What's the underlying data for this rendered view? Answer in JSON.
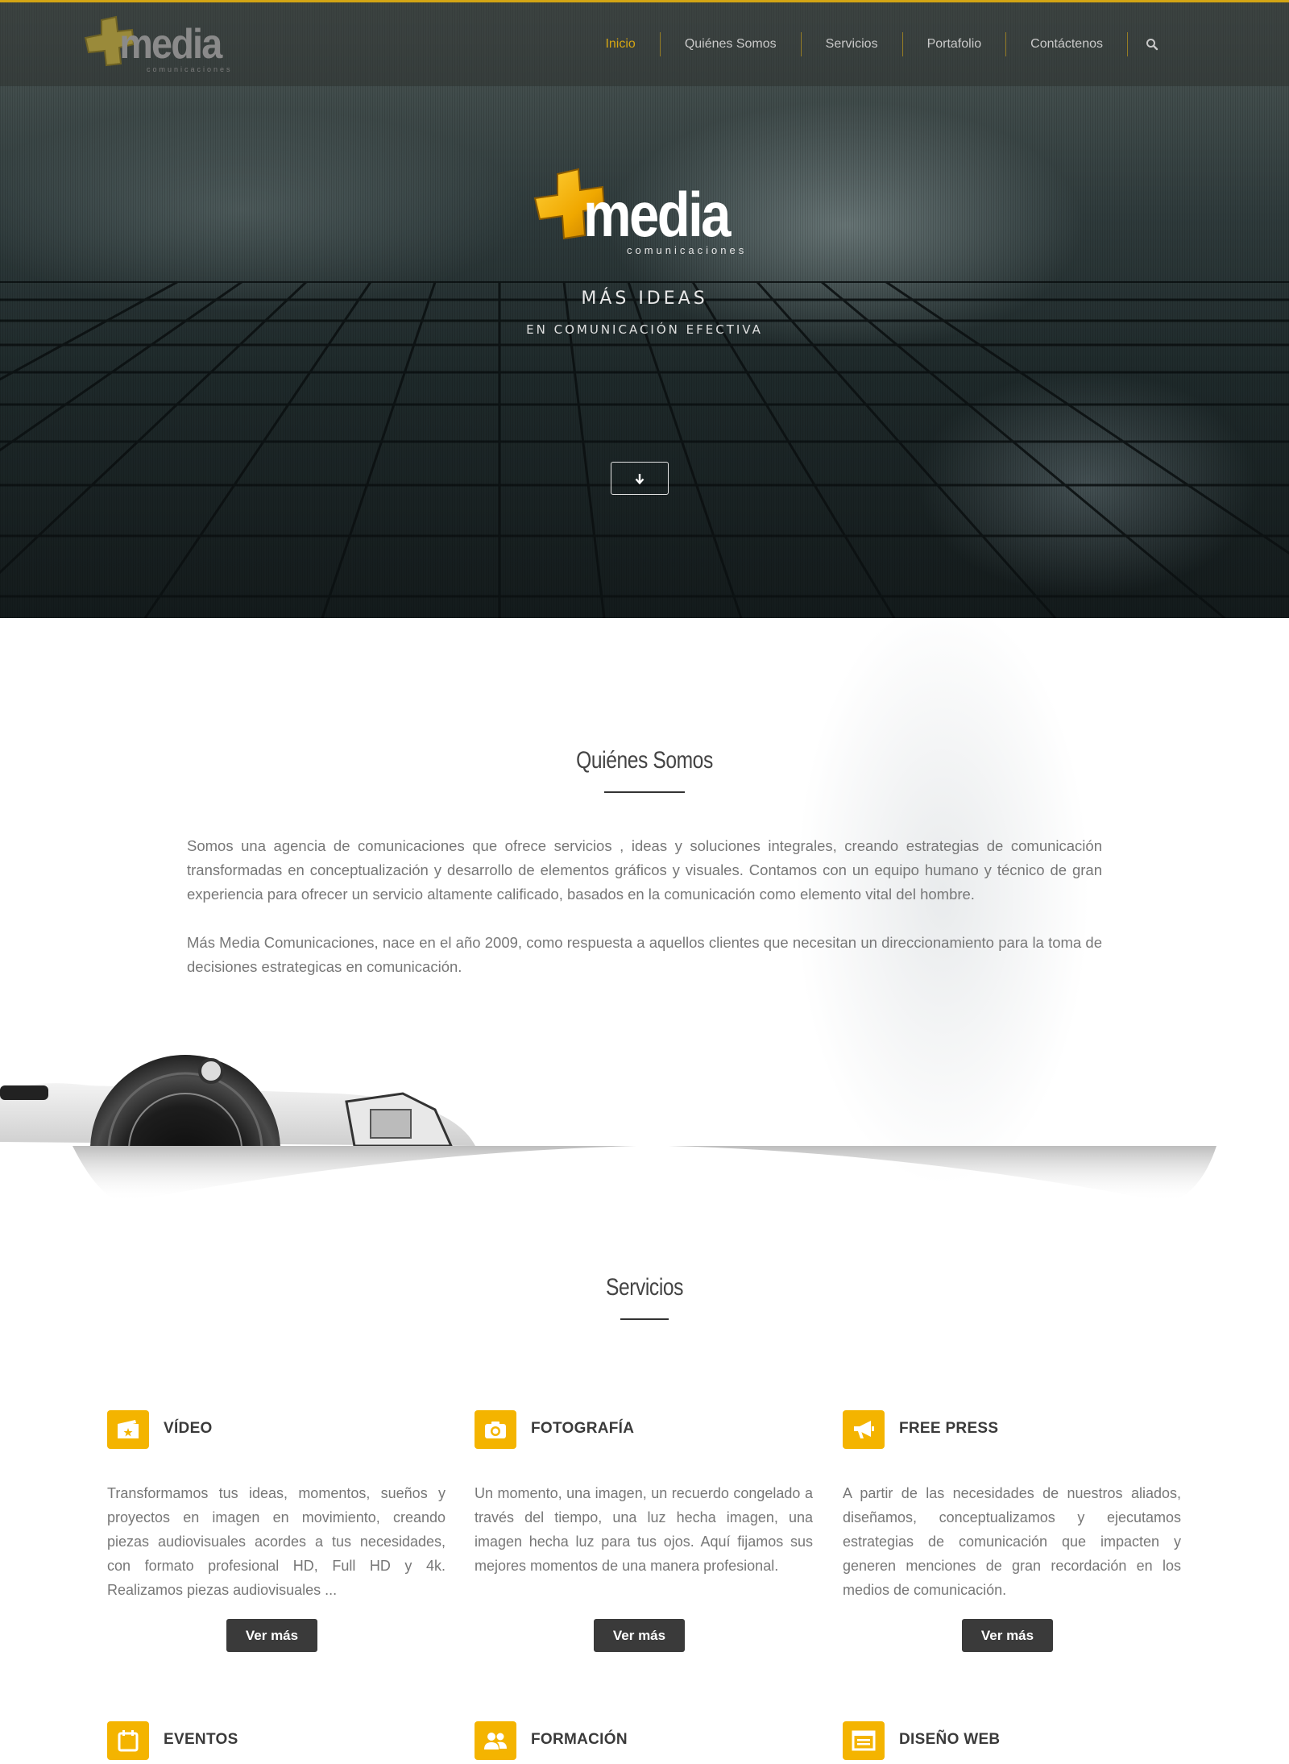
{
  "colors": {
    "accent": "#d4a514",
    "icon_bg": "#f4b400",
    "button_bg": "#3a3a3a"
  },
  "brand": {
    "logo_word": "media",
    "logo_tagline": "comunicaciones"
  },
  "nav": {
    "items": [
      {
        "label": "Inicio",
        "active": true
      },
      {
        "label": "Quiénes Somos"
      },
      {
        "label": "Servicios"
      },
      {
        "label": "Portafolio"
      },
      {
        "label": "Contáctenos"
      }
    ],
    "search_icon": "search-icon"
  },
  "hero": {
    "title": "MÁS IDEAS",
    "subtitle": "EN COMUNICACIÓN EFECTIVA",
    "scroll_icon": "arrow-down-icon"
  },
  "about": {
    "title": "Quiénes Somos",
    "paragraphs": [
      "Somos una agencia de comunicaciones que ofrece servicios , ideas y soluciones integrales, creando estrategias de comunicación transformadas en conceptualización y desarrollo de elementos gráficos y visuales. Contamos con un equipo humano y técnico de gran experiencia para ofrecer un servicio altamente calificado, basados en la comunicación como elemento vital del hombre.",
      "Más Media Comunicaciones, nace en el año 2009, como respuesta a aquellos clientes que necesitan un direccionamiento para la toma de decisiones estrategicas en comunicación."
    ]
  },
  "services": {
    "title": "Servicios",
    "items": [
      {
        "icon": "video-icon",
        "title": "VÍDEO",
        "text": "Transformamos tus ideas, momentos, sueños y proyectos en imagen en movimiento, creando piezas audiovisuales acordes a tus necesidades, con formato profesional HD, Full HD y 4k. Realizamos piezas audiovisuales ...",
        "button": "Ver más"
      },
      {
        "icon": "camera-icon",
        "title": "FOTOGRAFÍA",
        "text": "Un momento, una imagen, un recuerdo congelado a través del tiempo, una luz hecha imagen, una imagen hecha luz para tus ojos. Aquí fijamos sus mejores momentos de una manera profesional.",
        "button": "Ver más"
      },
      {
        "icon": "megaphone-icon",
        "title": "FREE PRESS",
        "text": "A partir de las necesidades de nuestros aliados, diseñamos, conceptualizamos y ejecutamos estrategias de comunicación que impacten y generen menciones de gran recordación en los medios de comunicación.",
        "button": "Ver más"
      },
      {
        "icon": "calendar-icon",
        "title": "EVENTOS"
      },
      {
        "icon": "people-icon",
        "title": "FORMACIÓN"
      },
      {
        "icon": "web-design-icon",
        "title": "DISEÑO WEB"
      }
    ]
  }
}
